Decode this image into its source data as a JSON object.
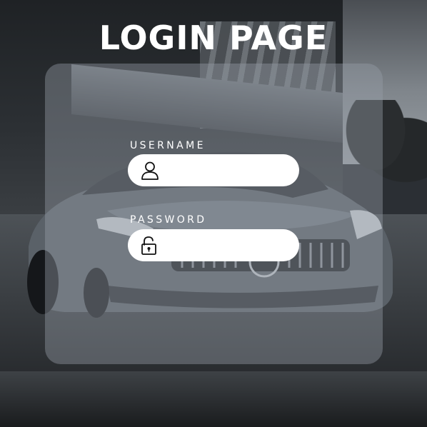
{
  "page": {
    "title": "LOGIN PAGE"
  },
  "form": {
    "username": {
      "label": "USERNAME",
      "value": "",
      "placeholder": "",
      "icon": "user-icon"
    },
    "password": {
      "label": "PASSWORD",
      "value": "",
      "placeholder": "",
      "icon": "unlocked-padlock-icon"
    }
  },
  "colors": {
    "title": "#ffffff",
    "card": "#969ea8",
    "field_bg": "#ffffff",
    "icon": "#111111"
  }
}
